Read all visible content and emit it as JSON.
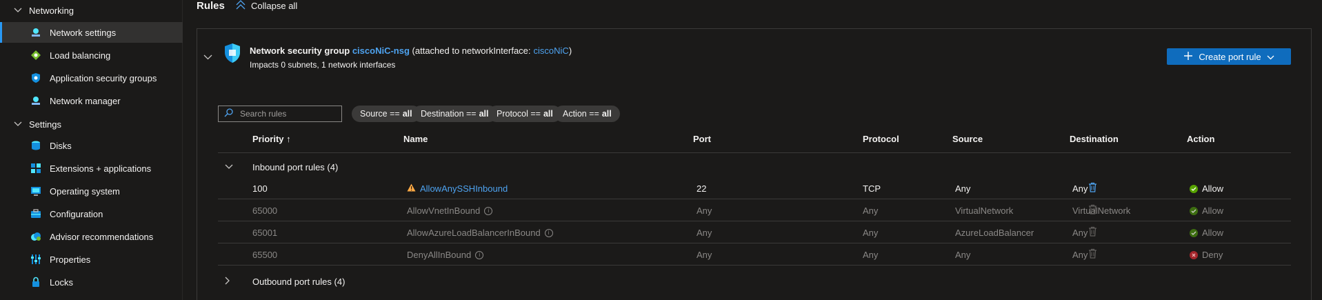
{
  "sidebar": {
    "groups": [
      {
        "label": "Networking"
      },
      {
        "label": "Settings"
      }
    ],
    "networking_items": [
      {
        "label": "Network settings",
        "icon": "network-settings-icon",
        "active": true
      },
      {
        "label": "Load balancing",
        "icon": "load-balancing-icon"
      },
      {
        "label": "Application security groups",
        "icon": "app-security-groups-icon"
      },
      {
        "label": "Network manager",
        "icon": "network-manager-icon"
      }
    ],
    "settings_items": [
      {
        "label": "Disks",
        "icon": "disks-icon"
      },
      {
        "label": "Extensions + applications",
        "icon": "extensions-icon"
      },
      {
        "label": "Operating system",
        "icon": "operating-system-icon"
      },
      {
        "label": "Configuration",
        "icon": "configuration-icon"
      },
      {
        "label": "Advisor recommendations",
        "icon": "advisor-icon"
      },
      {
        "label": "Properties",
        "icon": "properties-icon"
      },
      {
        "label": "Locks",
        "icon": "lock-icon"
      }
    ]
  },
  "header": {
    "title": "Rules",
    "collapse_all": "Collapse all"
  },
  "nsg": {
    "prefix": "Network security group",
    "name": "ciscoNiC-nsg",
    "attached_prefix": "(attached to networkInterface:",
    "interface": "ciscoNiC",
    "attached_suffix": ")",
    "impacts": "Impacts 0 subnets, 1 network interfaces",
    "create_button": "Create port rule"
  },
  "filters": {
    "search_placeholder": "Search rules",
    "pills": [
      {
        "key": "Source ==",
        "value": "all"
      },
      {
        "key": "Destination ==",
        "value": "all"
      },
      {
        "key": "Protocol ==",
        "value": "all"
      },
      {
        "key": "Action ==",
        "value": "all"
      }
    ]
  },
  "table": {
    "columns": [
      "Priority ↑",
      "Name",
      "Port",
      "Protocol",
      "Source",
      "Destination",
      "Action"
    ],
    "inbound_label": "Inbound port rules (4)",
    "outbound_label": "Outbound port rules (4)",
    "rows": [
      {
        "priority": "100",
        "name": "AllowAnySSHInbound",
        "port": "22",
        "protocol": "TCP",
        "source": "Any",
        "destination": "Any",
        "action": "Allow"
      },
      {
        "priority": "65000",
        "name": "AllowVnetInBound",
        "port": "Any",
        "protocol": "Any",
        "source": "VirtualNetwork",
        "destination": "VirtualNetwork",
        "action": "Allow"
      },
      {
        "priority": "65001",
        "name": "AllowAzureLoadBalancerInBound",
        "port": "Any",
        "protocol": "Any",
        "source": "AzureLoadBalancer",
        "destination": "Any",
        "action": "Allow"
      },
      {
        "priority": "65500",
        "name": "DenyAllInBound",
        "port": "Any",
        "protocol": "Any",
        "source": "Any",
        "destination": "Any",
        "action": "Deny"
      }
    ]
  },
  "colors": {
    "accent": "#0f6cbd",
    "link": "#4ea3f0",
    "allow": "#57a300",
    "deny": "#e81123",
    "warning": "#ffaa44"
  }
}
